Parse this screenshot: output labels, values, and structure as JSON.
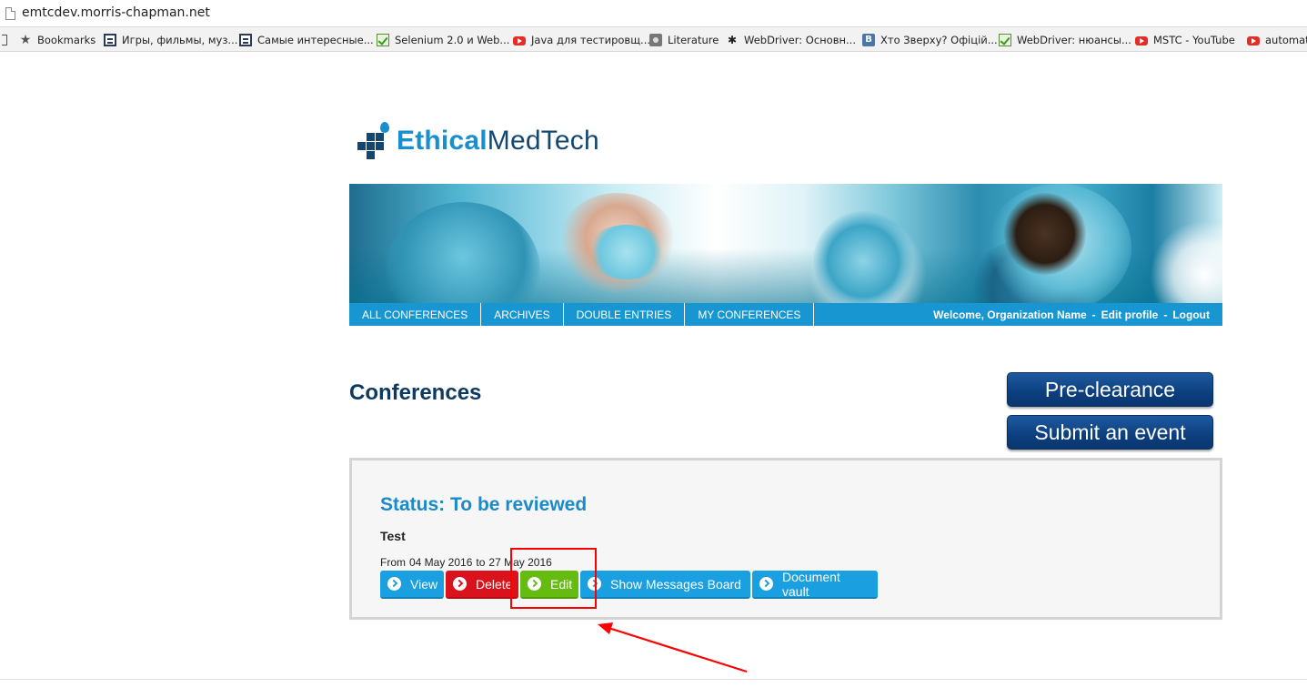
{
  "browser": {
    "url": "emtcdev.morris-chapman.net",
    "bookmarks": [
      {
        "label": "Bookmarks",
        "icon": "star-icon"
      },
      {
        "label": "Игры, фильмы, муз...",
        "icon": "bookmark-page-icon"
      },
      {
        "label": "Самые интересные...",
        "icon": "bookmark-page-icon"
      },
      {
        "label": "Selenium 2.0 и Web...",
        "icon": "checkmark-icon"
      },
      {
        "label": "Java для тестировщ...",
        "icon": "youtube-icon"
      },
      {
        "label": "Literature",
        "icon": "folder-icon"
      },
      {
        "label": "WebDriver: Основн...",
        "icon": "spider-icon"
      },
      {
        "label": "Хто Зверху? Офіцій...",
        "icon": "vk-icon"
      },
      {
        "label": "WebDriver: нюансы...",
        "icon": "checkmark-icon"
      },
      {
        "label": "MSTC - YouTube",
        "icon": "youtube-icon"
      },
      {
        "label": "automat",
        "icon": "youtube-icon"
      }
    ]
  },
  "site": {
    "logo": {
      "part1": "Ethical",
      "part2": "MedTech"
    },
    "nav": {
      "items": [
        "ALL CONFERENCES",
        "ARCHIVES",
        "DOUBLE ENTRIES",
        "MY CONFERENCES"
      ],
      "welcome": "Welcome, Organization Name",
      "edit_profile": "Edit profile",
      "logout": "Logout",
      "sep": "-"
    }
  },
  "main": {
    "title": "Conferences",
    "preclearance_label": "Pre-clearance",
    "submit_label": "Submit an event",
    "conference": {
      "status": "Status: To be reviewed",
      "name": "Test",
      "date_from_label": "From",
      "date_from": "04 May 2016",
      "date_to_label": "to",
      "date_to": "27 May 2016",
      "actions": {
        "view": "View",
        "delete": "Delete",
        "edit": "Edit",
        "messages": "Show Messages Board",
        "vault": "Document vault"
      }
    }
  },
  "colors": {
    "nav_bg": "#1896d2",
    "title": "#0e3a62",
    "status": "#1c8ac9",
    "btn_blue": "#1a9fe0",
    "btn_red": "#d9121b",
    "btn_green": "#66bb11",
    "annotation": "#ff0000"
  }
}
